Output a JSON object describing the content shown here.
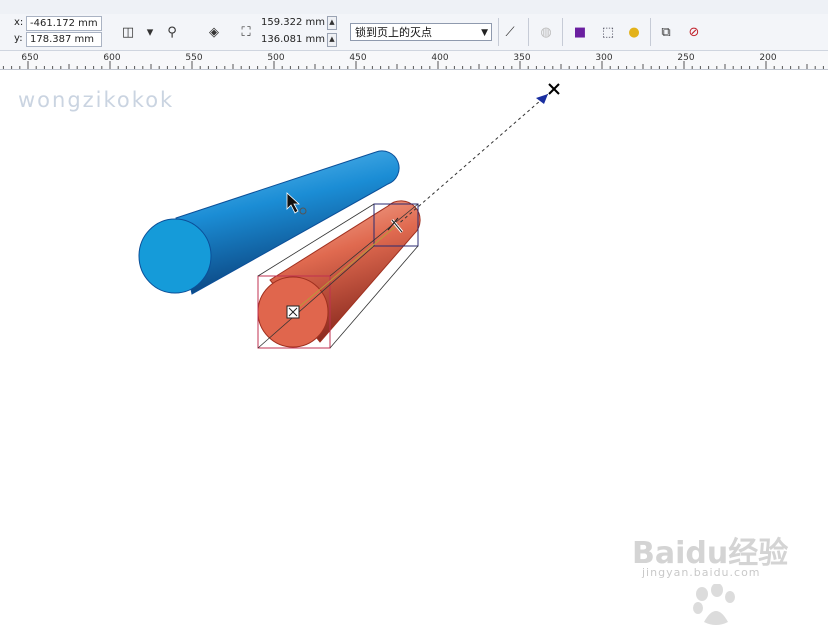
{
  "app": {
    "watermark_text": "wongzikokok",
    "baidu_watermark": "Baidu经验",
    "baidu_url": "jingyan.baidu.com"
  },
  "propbar": {
    "x_label": "x:",
    "x_value": "-461.172 mm",
    "y_label": "y:",
    "y_value": "178.387 mm",
    "w_value": "159.322 mm",
    "h_value": "136.081 mm",
    "vanish_point_mode": "锁到页上的灭点"
  },
  "ruler": {
    "labels": [
      "650",
      "600",
      "550",
      "500",
      "450",
      "400",
      "350",
      "300",
      "250",
      "200"
    ]
  },
  "icons": {
    "crosshair": "vanishing-point-cross-icon",
    "cursor": "pointer-cursor-icon",
    "move_handle": "extrude-move-handle-icon"
  },
  "colors": {
    "blue_cylinder": "#1a8fd6",
    "red_cylinder": "#e06a50",
    "bbox_line": "#c03050",
    "guide_line": "#333333",
    "vanish_arrow": "#1a2fa0"
  }
}
